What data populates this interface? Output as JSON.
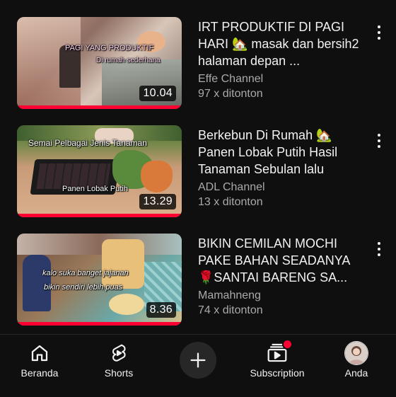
{
  "videos": [
    {
      "title": "IRT PRODUKTIF DI PAGI HARI 🏡 masak dan bersih2 halaman depan ...",
      "channel": "Effe Channel",
      "views": "97 x ditonton",
      "duration": "10.04",
      "overlay": [
        "PAGI YANG PRODUKTIF",
        "Di rumah sederhana"
      ]
    },
    {
      "title": "Berkebun Di Rumah 🏡 Panen  Lobak Putih Hasil Tanaman Sebulan lalu",
      "channel": "ADL Channel",
      "views": "13 x ditonton",
      "duration": "13.29",
      "overlay": [
        "Semai Pelbagai Jenis Tanaman",
        "Panen Lobak Putih"
      ]
    },
    {
      "title": "BIKIN CEMILAN MOCHI PAKE BAHAN SEADANYA 🌹SANTAI BARENG SA...",
      "channel": "Mamahneng",
      "views": "74 x ditonton",
      "duration": "8.36",
      "overlay": [
        "kalo suka banget jajanan",
        "bikin sendiri lebih puas"
      ]
    }
  ],
  "nav": {
    "home": "Beranda",
    "shorts": "Shorts",
    "subscription": "Subscription",
    "you": "Anda"
  },
  "colors": {
    "background": "#0f0f0f",
    "progress": "#ff0033",
    "notification_dot": "#ff0033",
    "secondary_text": "#aaaaaa"
  },
  "icons": [
    "home-icon",
    "shorts-icon",
    "create-plus-icon",
    "subscriptions-icon",
    "avatar"
  ]
}
